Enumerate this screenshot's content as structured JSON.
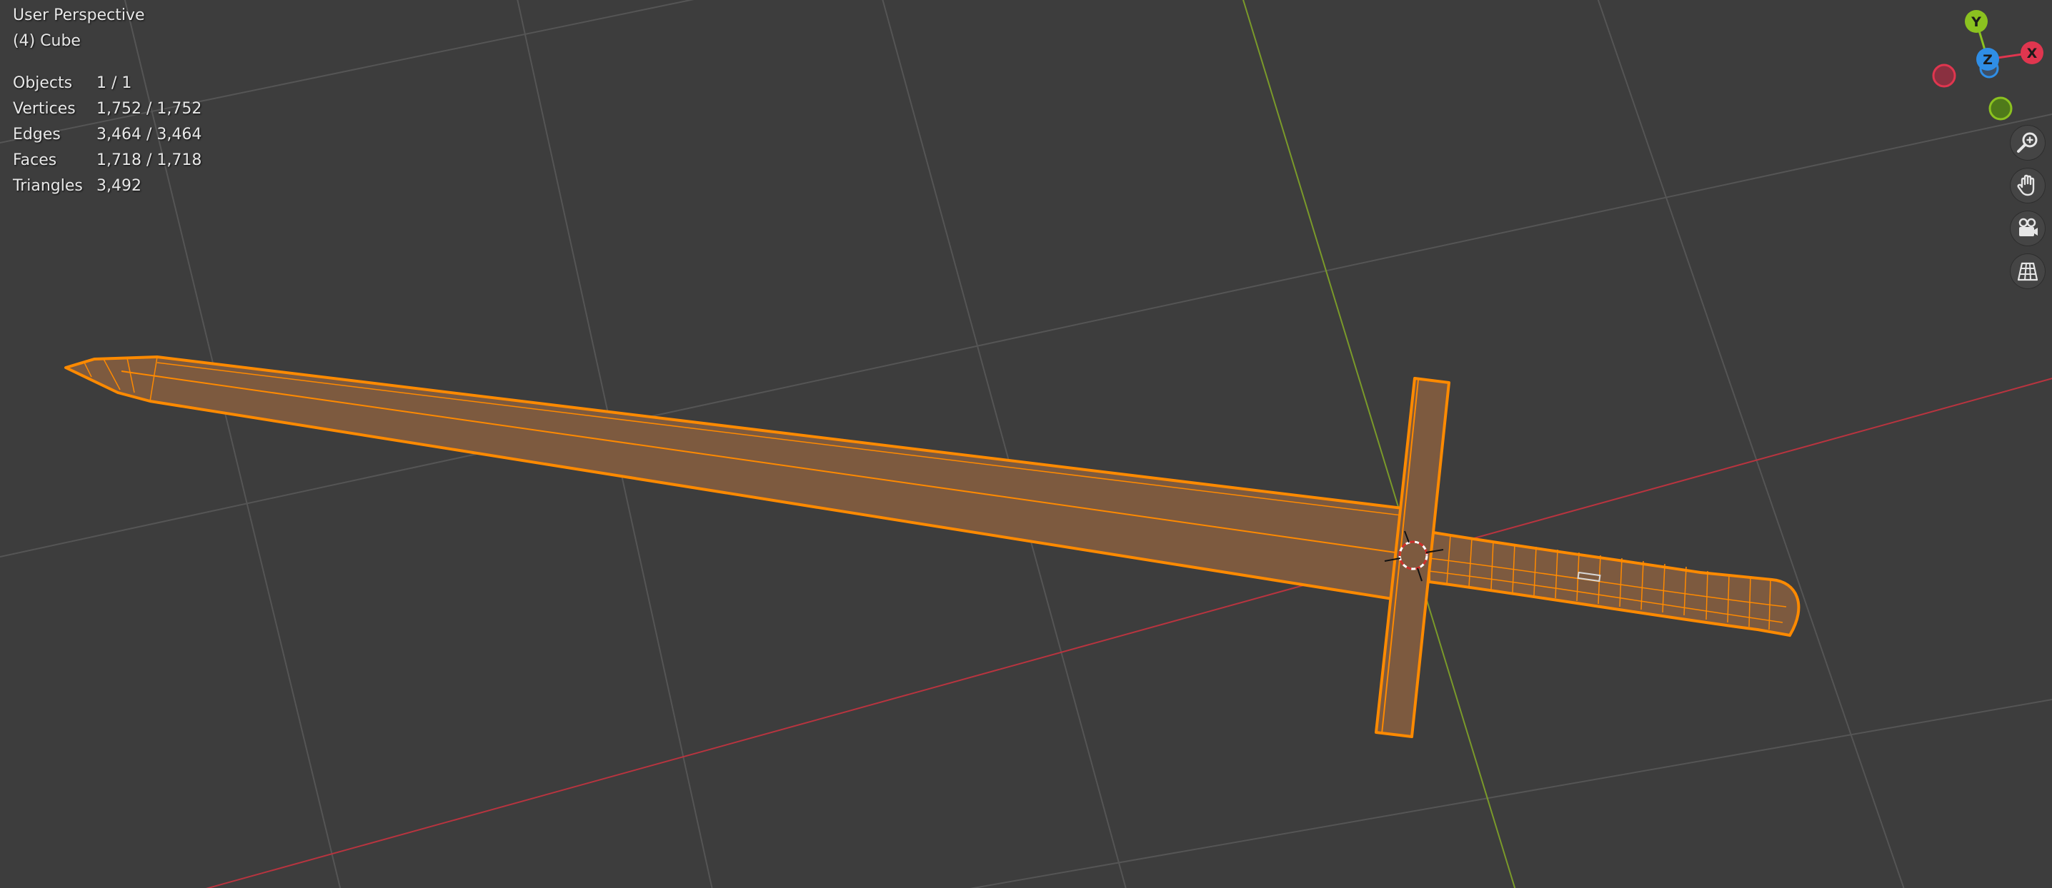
{
  "viewport": {
    "view_name": "User Perspective",
    "object_name": "(4) Cube",
    "stats": [
      {
        "label": "Objects",
        "value": "1 / 1"
      },
      {
        "label": "Vertices",
        "value": "1,752 / 1,752"
      },
      {
        "label": "Edges",
        "value": "3,464 / 3,464"
      },
      {
        "label": "Faces",
        "value": "1,718 / 1,718"
      },
      {
        "label": "Triangles",
        "value": "3,492"
      }
    ]
  },
  "gizmo": {
    "axes": [
      {
        "label": "Y",
        "color": "#8bc220"
      },
      {
        "label": "Z",
        "color": "#2f8ee6"
      },
      {
        "label": "X",
        "color": "#e0364f"
      }
    ]
  },
  "nav_tools": [
    {
      "name": "zoom",
      "icon": "magnifier-plus-icon"
    },
    {
      "name": "pan",
      "icon": "hand-icon"
    },
    {
      "name": "camera",
      "icon": "camera-icon"
    },
    {
      "name": "ortho",
      "icon": "grid-icon"
    }
  ],
  "colors": {
    "background": "#3d3d3d",
    "grid": "#555555",
    "x_axis": "#b8343f",
    "y_axis": "#7a9a2a",
    "selection": "#ff8a00",
    "mesh_face": "#7d5a3f"
  }
}
